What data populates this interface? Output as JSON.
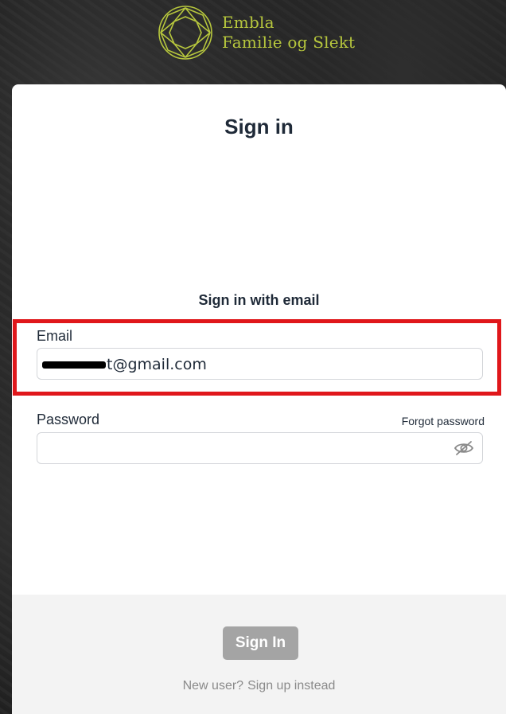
{
  "brand": {
    "line1": "Embla",
    "line2": "Familie og Slekt",
    "logo_icon": "gem-circle-logo",
    "color": "#b7c73d"
  },
  "signin": {
    "title": "Sign in",
    "section_title": "Sign in with email",
    "email_label": "Email",
    "email_value_visible": "t@gmail.com",
    "email_redacted": true,
    "password_label": "Password",
    "forgot_password": "Forgot password",
    "password_toggle_icon": "eye-off-icon",
    "submit_label": "Sign In",
    "new_user_text": "New user?",
    "signup_link": "Sign up instead"
  },
  "annotation": {
    "highlight_color": "#e0171b"
  }
}
